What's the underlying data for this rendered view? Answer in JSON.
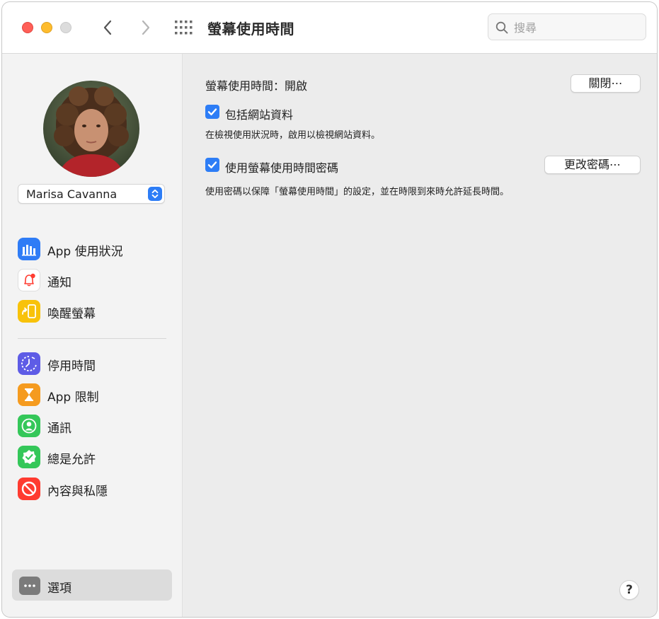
{
  "window": {
    "title": "螢幕使用時間",
    "search_placeholder": "搜尋"
  },
  "sidebar": {
    "user_name": "Marisa Cavanna",
    "items": [
      {
        "label": "App 使用狀況",
        "icon": "chart-bars-icon",
        "color": "#2f7cf6"
      },
      {
        "label": "通知",
        "icon": "bell-icon",
        "color": "#ffffff"
      },
      {
        "label": "喚醒螢幕",
        "icon": "phone-pickup-icon",
        "color": "#f8c20a"
      },
      {
        "label": "停用時間",
        "icon": "downtime-icon",
        "color": "#5e5ce6"
      },
      {
        "label": "App 限制",
        "icon": "hourglass-icon",
        "color": "#f59b1f"
      },
      {
        "label": "通訊",
        "icon": "contact-icon",
        "color": "#34c759"
      },
      {
        "label": "總是允許",
        "icon": "checkmark-badge-icon",
        "color": "#34c759"
      },
      {
        "label": "內容與私隱",
        "icon": "no-entry-icon",
        "color": "#ff3b30"
      }
    ],
    "options_label": "選項"
  },
  "main": {
    "status_label": "螢幕使用時間：開啟",
    "turn_off_button": "關閉⋯",
    "include_website_label": "包括網站資料",
    "include_website_checked": true,
    "include_website_desc": "在檢視使用狀況時，啟用以檢視網站資料。",
    "passcode_label": "使用螢幕使用時間密碼",
    "passcode_checked": true,
    "change_passcode_button": "更改密碼⋯",
    "passcode_desc": "使用密碼以保障「螢幕使用時間」的設定，並在時限到來時允許延長時間。",
    "help_label": "?"
  }
}
